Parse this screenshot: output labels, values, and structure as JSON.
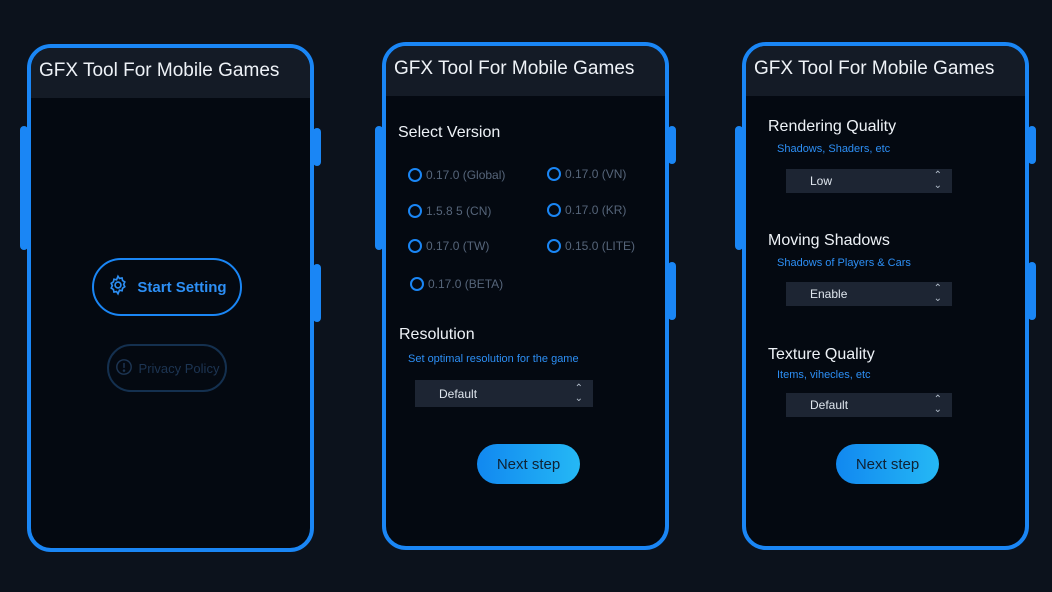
{
  "app_title": "GFX Tool For Mobile Games",
  "screen1": {
    "start_setting": "Start Setting",
    "privacy_policy": "Privacy Policy"
  },
  "screen2": {
    "select_version_title": "Select Version",
    "versions_left": [
      "0.17.0 (Global)",
      "1.5.8 5 (CN)",
      "0.17.0 (TW)",
      "0.17.0 (BETA)"
    ],
    "versions_right": [
      "0.17.0 (VN)",
      "0.17.0 (KR)",
      "0.15.0 (LITE)"
    ],
    "resolution_title": "Resolution",
    "resolution_sub": "Set optimal resolution for the game",
    "resolution_value": "Default",
    "next_step": "Next step"
  },
  "screen3": {
    "rendering_title": "Rendering Quality",
    "rendering_sub": "Shadows, Shaders, etc",
    "rendering_value": "Low",
    "shadows_title": "Moving Shadows",
    "shadows_sub": "Shadows of Players & Cars",
    "shadows_value": "Enable",
    "texture_title": "Texture Quality",
    "texture_sub": "Items, vihecles, etc",
    "texture_value": "Default",
    "next_step": "Next step"
  },
  "colors": {
    "accent": "#1a86f5",
    "background": "#0c121c",
    "screen": "#040911",
    "appbar": "#141b26"
  }
}
